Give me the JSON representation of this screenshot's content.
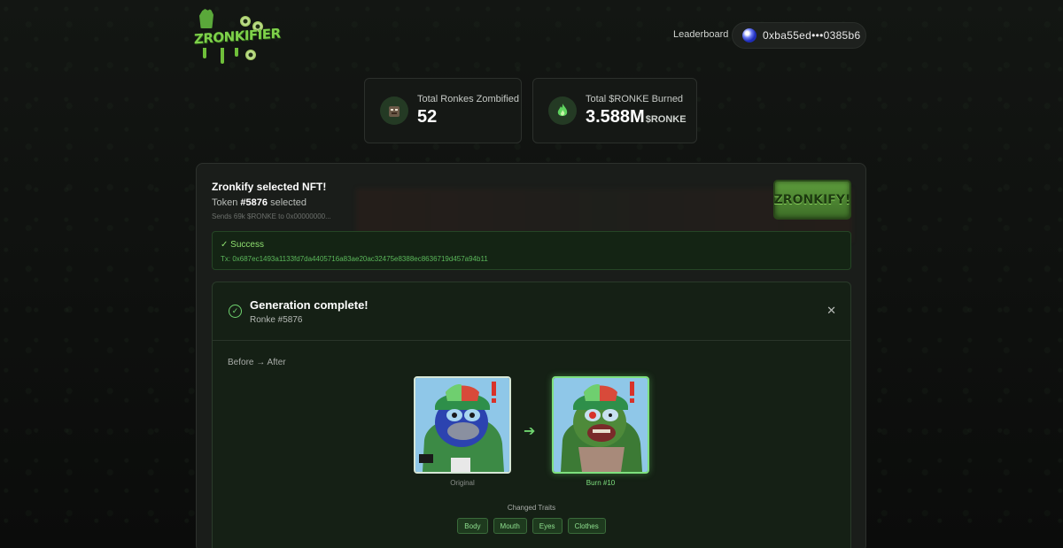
{
  "header": {
    "logo_text": "ZRONKIFIER",
    "nav_leaderboard": "Leaderboard",
    "wallet_address": "0xba55ed•••0385b6"
  },
  "stats": [
    {
      "label": "Total Ronkes Zombified",
      "value": "52",
      "unit": "",
      "icon": "zombie-avatar-icon"
    },
    {
      "label": "Total $RONKE Burned",
      "value": "3.588M",
      "unit": "$RONKE",
      "icon": "flame-icon"
    }
  ],
  "zronkify": {
    "title": "Zronkify selected NFT!",
    "token_prefix": "Token ",
    "token_id": "#5876",
    "token_suffix": " selected",
    "sends_text": "Sends 69k $RONKE to 0x00000000...",
    "button_label": "ZRONKIFY!"
  },
  "success": {
    "title": "✓ Success",
    "tx": "Tx: 0x687ec1493a1133fd7da4405716a83ae20ac32475e8388ec8636719d457a94b11"
  },
  "generation": {
    "title": "Generation complete!",
    "subtitle": "Ronke #5876",
    "before_after_label": "Before → After",
    "original_caption": "Original",
    "burn_caption": "Burn #10",
    "changed_traits_label": "Changed Traits",
    "traits": [
      "Body",
      "Mouth",
      "Eyes",
      "Clothes"
    ]
  },
  "colors": {
    "accent": "#6fd36f",
    "background": "#0d0f0d",
    "panel": "#1a1d1a"
  }
}
